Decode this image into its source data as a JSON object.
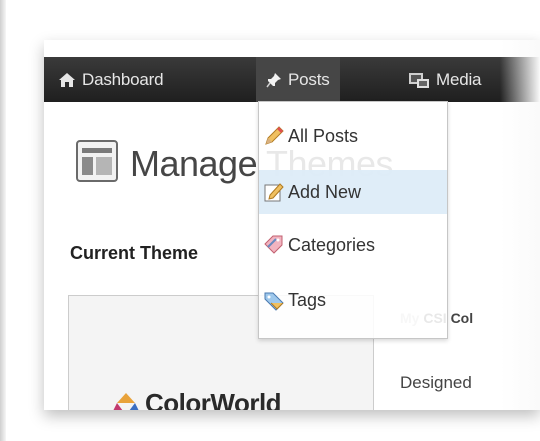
{
  "topbar": {
    "items": [
      {
        "label": "Dashboard",
        "icon": "home-icon"
      },
      {
        "label": "Posts",
        "icon": "pushpin-icon"
      },
      {
        "label": "Media",
        "icon": "media-icon"
      }
    ]
  },
  "posts_menu": {
    "items": [
      {
        "label": "All Posts",
        "icon": "pencil-icon"
      },
      {
        "label": "Add New",
        "icon": "pencil-edit-icon"
      },
      {
        "label": "Categories",
        "icon": "category-tag-icon"
      },
      {
        "label": "Tags",
        "icon": "tag-icon"
      }
    ],
    "hovered_index": 1
  },
  "page": {
    "title": "Manage Themes",
    "current_theme_heading": "Current Theme",
    "theme_name_visible": "CSI Col",
    "theme_name_faint": "My ",
    "author_prefix": "Designed",
    "logo_text": "ColorWorld"
  },
  "colors": {
    "topbar": "#222222",
    "hover_row": "#ddecf8",
    "title": "#464646"
  }
}
